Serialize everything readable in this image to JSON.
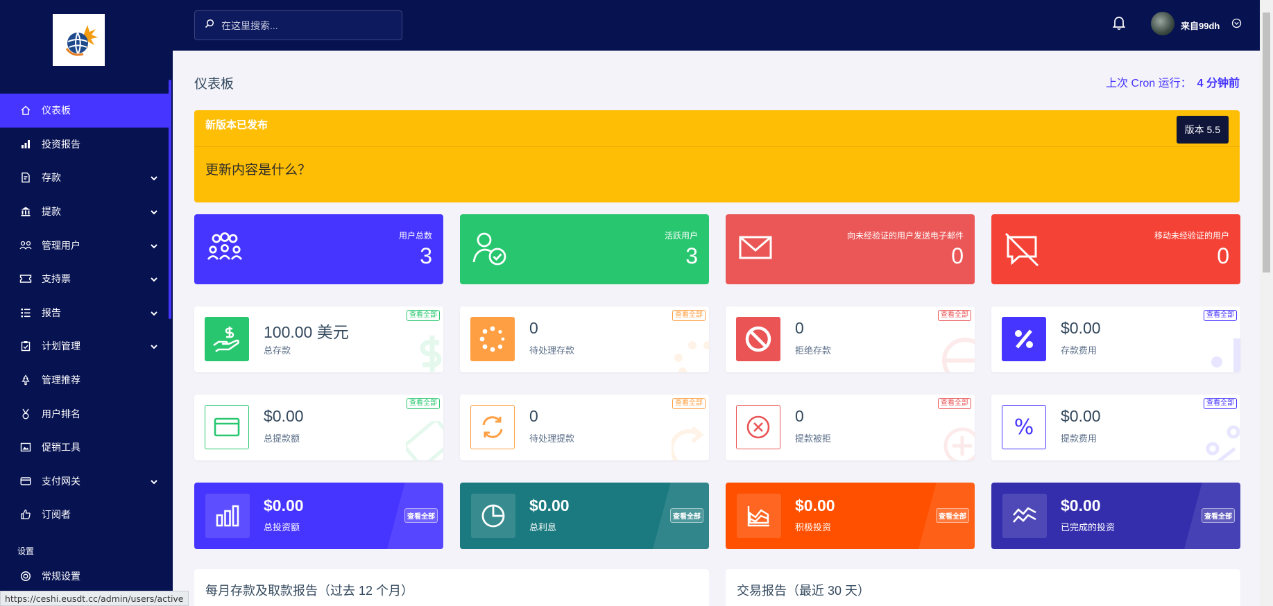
{
  "sidebar": {
    "items": [
      {
        "label": "仪表板",
        "icon": "home-icon"
      },
      {
        "label": "投资报告",
        "icon": "bar-chart-icon"
      },
      {
        "label": "存款",
        "icon": "deposit-icon"
      },
      {
        "label": "提款",
        "icon": "bank-icon"
      },
      {
        "label": "管理用户",
        "icon": "users-icon"
      },
      {
        "label": "支持票",
        "icon": "ticket-icon"
      },
      {
        "label": "报告",
        "icon": "list-icon"
      },
      {
        "label": "计划管理",
        "icon": "clipboard-check-icon"
      },
      {
        "label": "管理推荐",
        "icon": "tree-icon"
      },
      {
        "label": "用户排名",
        "icon": "medal-icon"
      },
      {
        "label": "促销工具",
        "icon": "image-icon"
      },
      {
        "label": "支付网关",
        "icon": "card-icon"
      },
      {
        "label": "订阅者",
        "icon": "thumbs-up-icon"
      }
    ],
    "section_label": "设置",
    "settings_label": "常规设置",
    "accent": "#4634ff",
    "background": "#071251"
  },
  "statusbar": {
    "url": "https://ceshi.eusdt.cc/admin/users/active"
  },
  "topbar": {
    "search_placeholder": "在这里搜索...",
    "username": "来自99dh"
  },
  "header": {
    "title": "仪表板",
    "cron_label": "上次 Cron 运行：",
    "cron_value": "4 分钟前"
  },
  "banner": {
    "title": "新版本已发布",
    "version": "版本 5.5",
    "body": "更新内容是什么？",
    "color": "#ffbe06"
  },
  "user_cards": [
    {
      "label": "用户总数",
      "value": "3",
      "color": "#4634ff",
      "icon": "users-group-icon"
    },
    {
      "label": "活跃用户",
      "value": "3",
      "color": "#28c76f",
      "icon": "user-check-icon"
    },
    {
      "label": "向未经验证的用户发送电子邮件",
      "value": "0",
      "color": "#eb5757",
      "icon": "envelope-icon"
    },
    {
      "label": "移动未经验证的用户",
      "value": "0",
      "color": "#f44336",
      "icon": "comment-slash-icon"
    }
  ],
  "deposit_cards": [
    {
      "value": "100.00 美元",
      "label": "总存款",
      "link": "查看全部",
      "color": "#28c76f",
      "icon": "hand-dollar-icon"
    },
    {
      "value": "0",
      "label": "待处理存款",
      "link": "查看全部",
      "color": "#ff9f43",
      "icon": "spinner-icon"
    },
    {
      "value": "0",
      "label": "拒绝存款",
      "link": "查看全部",
      "color": "#ea5455",
      "icon": "ban-icon"
    },
    {
      "value": "$0.00",
      "label": "存款费用",
      "link": "查看全部",
      "color": "#4634ff",
      "icon": "percent-icon"
    }
  ],
  "withdraw_cards": [
    {
      "value": "$0.00",
      "label": "总提款额",
      "link": "查看全部",
      "color": "#28c76f",
      "icon": "credit-card-icon"
    },
    {
      "value": "0",
      "label": "待处理提款",
      "link": "查看全部",
      "color": "#ff9f43",
      "icon": "sync-icon"
    },
    {
      "value": "0",
      "label": "提款被拒",
      "link": "查看全部",
      "color": "#ea5455",
      "icon": "times-circle-icon"
    },
    {
      "value": "$0.00",
      "label": "提款费用",
      "link": "查看全部",
      "color": "#4634ff",
      "icon": "percent-icon"
    }
  ],
  "invest_cards": [
    {
      "value": "$0.00",
      "label": "总投资额",
      "link": "查看全部",
      "color": "#4634ff",
      "icon": "bar-chart-icon"
    },
    {
      "value": "$0.00",
      "label": "总利息",
      "link": "查看全部",
      "color": "#1b7a7f",
      "icon": "pie-chart-icon"
    },
    {
      "value": "$0.00",
      "label": "积极投资",
      "link": "查看全部",
      "color": "#ff5000",
      "icon": "area-chart-icon"
    },
    {
      "value": "$0.00",
      "label": "已完成的投资",
      "link": "查看全部",
      "color": "#342ead",
      "icon": "line-chart-icon"
    }
  ],
  "panels": [
    {
      "title": "每月存款及取款报告（过去 12 个月）"
    },
    {
      "title": "交易报告（最近 30 天）"
    }
  ]
}
